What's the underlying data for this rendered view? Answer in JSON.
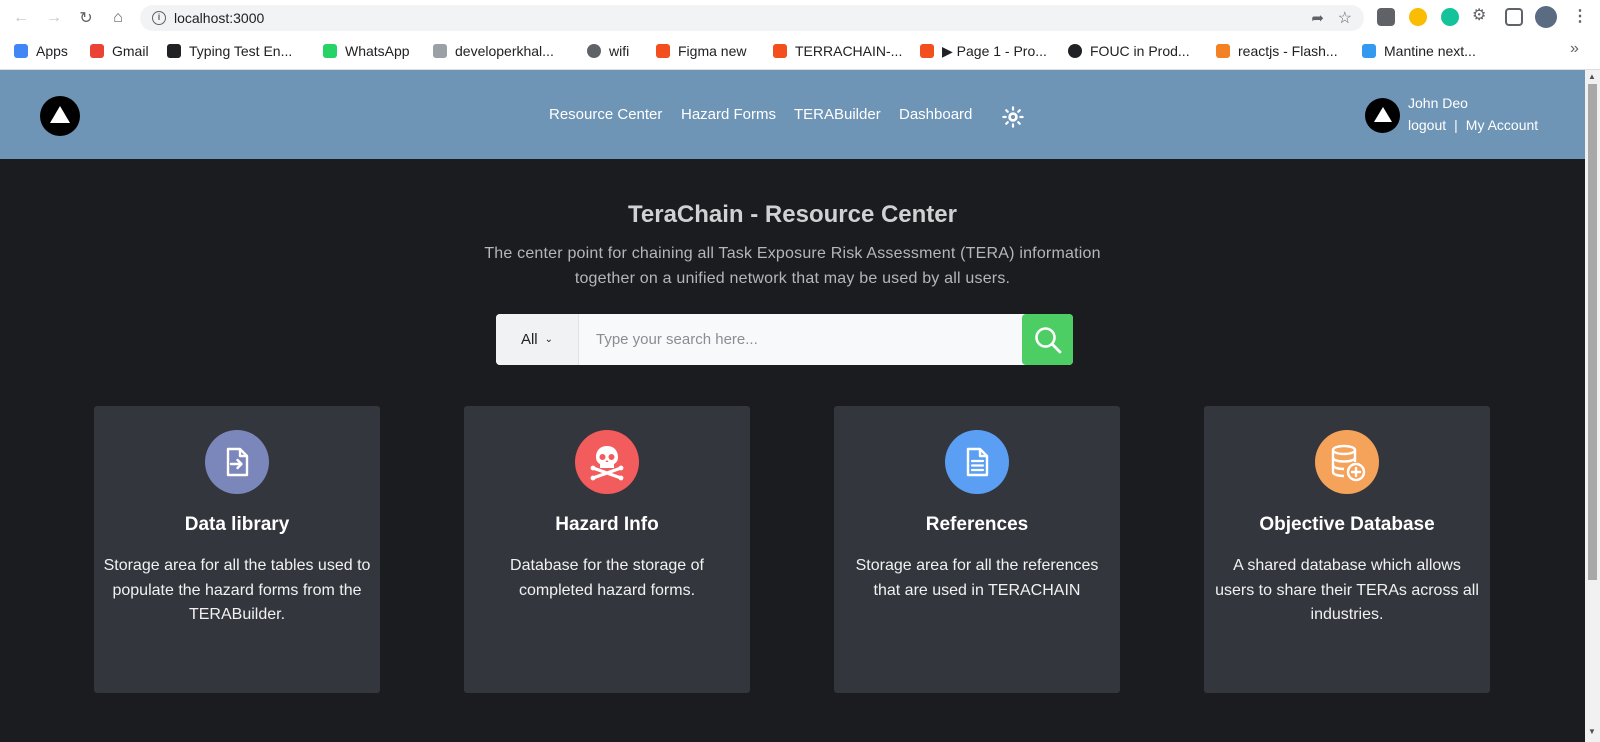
{
  "browser": {
    "url": "localhost:3000",
    "bookmarks": [
      {
        "label": "Apps",
        "icon": "apps-grid-icon",
        "color": "#4285f4"
      },
      {
        "label": "Gmail",
        "icon": "gmail-icon",
        "color": "#ea4335"
      },
      {
        "label": "Typing Test En...",
        "icon": "typing-test-icon",
        "color": "#202124"
      },
      {
        "label": "WhatsApp",
        "icon": "whatsapp-icon",
        "color": "#25d366"
      },
      {
        "label": "developerkhal...",
        "icon": "dev-icon",
        "color": "#9aa0a6"
      },
      {
        "label": "wifi",
        "icon": "globe-icon",
        "color": "#5f6368"
      },
      {
        "label": "Figma new",
        "icon": "figma-icon",
        "color": "#f24e1e"
      },
      {
        "label": "TERRACHAIN-...",
        "icon": "figma-icon",
        "color": "#f24e1e"
      },
      {
        "label": "▶ Page 1 - Pro...",
        "icon": "figma-icon",
        "color": "#f24e1e"
      },
      {
        "label": "FOUC in Prod...",
        "icon": "github-icon",
        "color": "#202124"
      },
      {
        "label": "reactjs - Flash...",
        "icon": "stackoverflow-icon",
        "color": "#f48024"
      },
      {
        "label": "Mantine next...",
        "icon": "mantine-icon",
        "color": "#339af0"
      }
    ]
  },
  "header": {
    "nav": [
      "Resource Center",
      "Hazard Forms",
      "TERABuilder",
      "Dashboard"
    ],
    "user_name": "John Deo",
    "logout": "logout",
    "separator": "|",
    "my_account": "My Account",
    "bg_color": "#6e94b6"
  },
  "hero": {
    "title": "TeraChain - Resource Center",
    "subtitle": "The center point for chaining all Task Exposure Risk Assessment (TERA) information together on a unified network that may be used by all users."
  },
  "search": {
    "category": "All",
    "placeholder": "Type your search here...",
    "button_color": "#4cce64"
  },
  "cards": [
    {
      "title": "Data library",
      "description": "Storage area for all the tables used to populate the hazard forms from the TERABuilder.",
      "icon": "file-import-icon",
      "color": "#7b86ba"
    },
    {
      "title": "Hazard Info",
      "description": "Database for the storage of completed hazard forms.",
      "icon": "skull-crossbones-icon",
      "color": "#f25c5c"
    },
    {
      "title": "References",
      "description": "Storage area for all the references that are used in TERACHAIN",
      "icon": "document-text-icon",
      "color": "#5b9ff5"
    },
    {
      "title": "Objective Database",
      "description": "A shared database which allows users to share their TERAs across all industries.",
      "icon": "database-plus-icon",
      "color": "#f5a25b"
    }
  ]
}
